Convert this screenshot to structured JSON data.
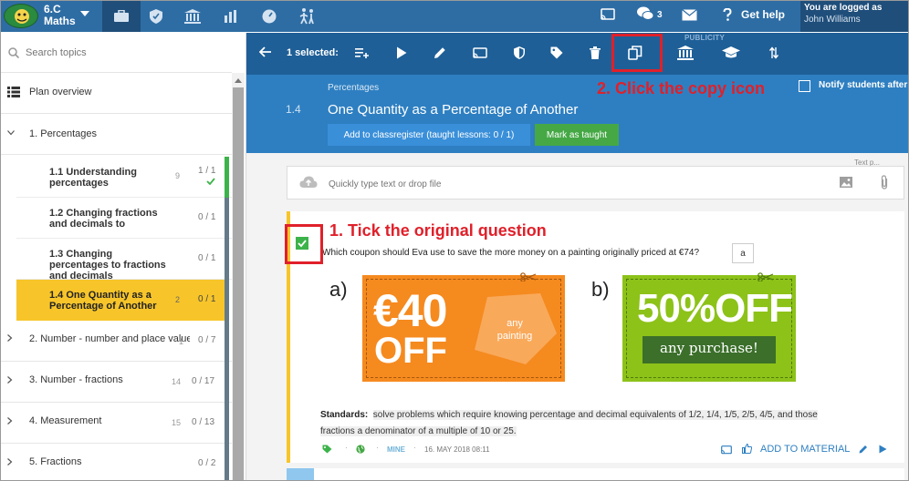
{
  "topbar": {
    "class_name": "6.C Maths",
    "message_count": "3",
    "help_label": "Get help",
    "logged_in_label": "You are logged as",
    "user_name": "John Williams"
  },
  "sidebar": {
    "search_placeholder": "Search topics",
    "plan_overview": "Plan overview",
    "topics": [
      {
        "label": "1. Percentages"
      },
      {
        "label": "2. Number - number and place value",
        "count": "1",
        "progress": "0 / 7"
      },
      {
        "label": "3. Number - fractions",
        "count": "14",
        "progress": "0 / 17"
      },
      {
        "label": "4. Measurement",
        "count": "15",
        "progress": "0 / 13"
      },
      {
        "label": "5. Fractions",
        "progress": "0 / 2"
      }
    ],
    "subtopics": [
      {
        "label": "1.1 Understanding percentages",
        "count": "9",
        "progress": "1 / 1"
      },
      {
        "label": "1.2 Changing fractions and decimals to",
        "progress": "0 / 1"
      },
      {
        "label": "1.3 Changing percentages to fractions and decimals",
        "progress": "0 / 1"
      },
      {
        "label": "1.4 One Quantity as a Percentage of Another",
        "count": "2",
        "progress": "0 / 1"
      }
    ]
  },
  "toolbar": {
    "selected_label": "1 selected:",
    "publicity_label": "PUBLICITY"
  },
  "header": {
    "topic_number": "1.4",
    "breadcrumb": "Percentages",
    "title": "One Quantity as a Percentage of Another",
    "classregister_button": "Add to classregister (taught lessons: 0 / 1)",
    "mark_taught_button": "Mark as taught",
    "notify_text": "Notify students after completing this topic"
  },
  "content": {
    "text_cut": "Text p...",
    "quick_placeholder": "Quickly type text or drop file",
    "question": "Which coupon should Eva use to save the more money on a painting originally priced at €74?",
    "answer_marker": "a",
    "option_a": "a)",
    "option_b": "b)",
    "coupon_a": {
      "amount": "€40",
      "off": "OFF",
      "note": "any painting"
    },
    "coupon_b": {
      "amount": "50%OFF",
      "note": "any purchase!"
    },
    "standards_label": "Standards:",
    "standards_text_1": "solve problems which require knowing percentage and decimal equivalents of 1/2, 1/4, 1/5, 2/5, 4/5, and those",
    "standards_text_2": "fractions a denominator of a multiple of 10 or 25.",
    "meta_owner": "MINE",
    "meta_date": "16. MAY 2018 08:11",
    "add_material": "ADD TO MATERIAL"
  },
  "annotations": {
    "step1": "1. Tick the original question",
    "step2": "2. Click the copy icon"
  },
  "colors": {
    "topbar": "#2e6da4",
    "toolbar": "#1e5f97",
    "header": "#2e7fc1",
    "active_topic": "#f7c52a",
    "annotation": "#e0202a",
    "coupon_orange": "#f58a1f",
    "coupon_green": "#8dc219"
  }
}
